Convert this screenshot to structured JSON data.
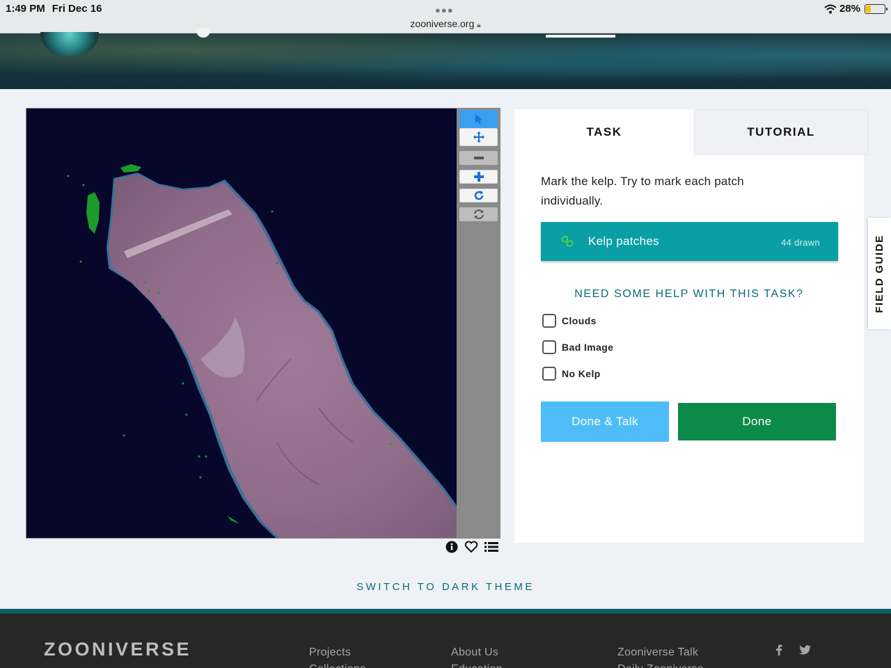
{
  "status_bar": {
    "time": "1:49 PM",
    "date": "Fri Dec 16",
    "url": "zooniverse.org",
    "battery_percent_label": "28%",
    "battery_level": 0.28,
    "battery_color": "#f1c500",
    "icons": [
      "wifi-icon",
      "lock-icon",
      "battery-icon"
    ]
  },
  "viewer": {
    "tools": [
      "pointer-icon",
      "move-icon",
      "zoom-out-icon",
      "zoom-in-icon",
      "rotate-icon",
      "reset-icon"
    ],
    "meta_icons": [
      "info-icon",
      "heart-icon",
      "list-icon"
    ]
  },
  "task_panel": {
    "tabs": [
      {
        "label": "TASK",
        "active": true
      },
      {
        "label": "TUTORIAL",
        "active": false
      }
    ],
    "instruction": "Mark the kelp. Try to mark each patch individually.",
    "kelp_tool": {
      "label": "Kelp patches",
      "count": "44 drawn",
      "color": "#0a9fa4",
      "icon": "kelp-outline-icon"
    },
    "help_link": "NEED SOME HELP WITH THIS TASK?",
    "checkboxes": [
      {
        "label": "Clouds",
        "checked": false
      },
      {
        "label": "Bad Image",
        "checked": false
      },
      {
        "label": "No Kelp",
        "checked": false
      }
    ],
    "buttons": {
      "done_talk": "Done & Talk",
      "done": "Done"
    }
  },
  "field_guide": "FIELD GUIDE",
  "theme_switch": "SWITCH TO DARK THEME",
  "footer": {
    "brand": "ZOONIVERSE",
    "columns": [
      [
        "Projects",
        "Collections"
      ],
      [
        "About Us",
        "Education"
      ],
      [
        "Zooniverse Talk",
        "Daily Zooniverse"
      ]
    ],
    "social": [
      "facebook-icon",
      "twitter-icon"
    ]
  },
  "colors": {
    "accent_teal": "#0a9fa4",
    "done_green": "#0c8a4a",
    "talk_blue": "#4ebdf7",
    "link_teal": "#0b6a78"
  }
}
